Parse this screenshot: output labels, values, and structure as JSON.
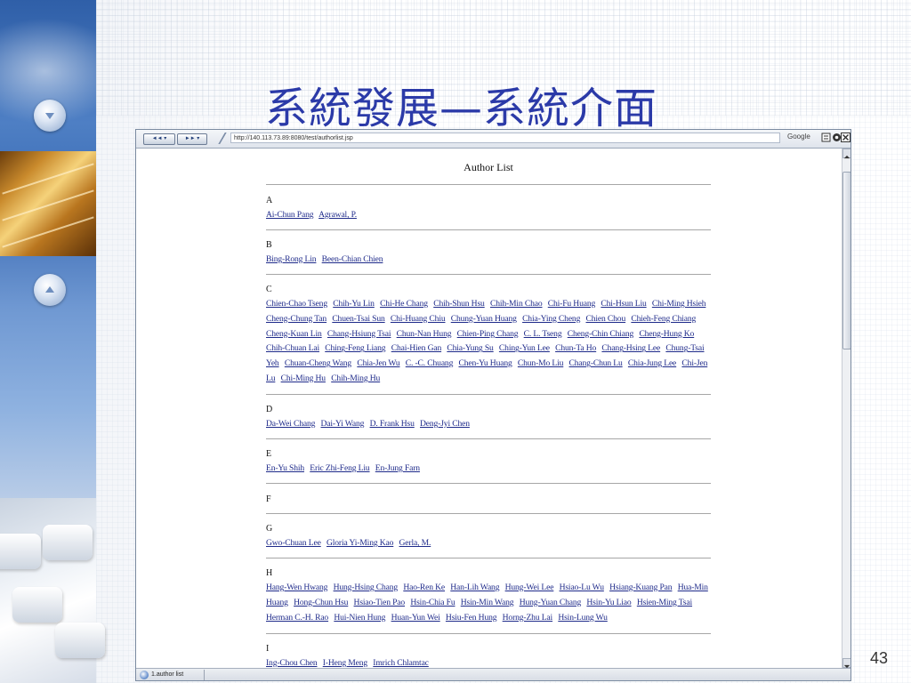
{
  "slide": {
    "title": "系統發展—系統介面",
    "page_number": "43"
  },
  "browser": {
    "back_label": "◄◄ ▾",
    "forward_label": "►► ▾",
    "address": "http://140.113.73.89:8080/test/authorlist.jsp",
    "search_engine": "Google",
    "status_text": "1.author list"
  },
  "author_list": {
    "title": "Author List",
    "sections": [
      {
        "letter": "A",
        "names": [
          "Ai-Chun Pang",
          "Agrawal, P."
        ]
      },
      {
        "letter": "B",
        "names": [
          "Bing-Rong Lin",
          "Been-Chian Chien"
        ]
      },
      {
        "letter": "C",
        "names": [
          "Chien-Chao Tseng",
          "Chih-Yu Lin",
          "Chi-He Chang",
          "Chih-Shun Hsu",
          "Chih-Min Chao",
          "Chi-Fu Huang",
          "Chi-Hsun Liu",
          "Chi-Ming Hsieh",
          "Cheng-Chung Tan",
          "Chuen-Tsai Sun",
          "Chi-Huang Chiu",
          "Chung-Yuan Huang",
          "Chia-Ying Cheng",
          "Chien Chou",
          "Chieh-Feng Chiang",
          "Cheng-Kuan Lin",
          "Chang-Hsiung Tsai",
          "Chun-Nan Hung",
          "Chien-Ping Chang",
          "C. L. Tseng",
          "Cheng-Chin Chiang",
          "Cheng-Hung Ko",
          "Chih-Chuan Lai",
          "Ching-Feng Liang",
          "Chai-Hien Gan",
          "Chia-Yung Su",
          "Ching-Yun Lee",
          "Chun-Ta Ho",
          "Chang-Hsing Lee",
          "Chung-Tsai Yeh",
          "Chuan-Cheng Wang",
          "Chia-Jen Wu",
          "C. -C. Chuang",
          "Chen-Yu Huang",
          "Chun-Mo Liu",
          "Chang-Chun Lu",
          "Chia-Jung Lee",
          "Chi-Jen Lu",
          "Chi-Ming Hu",
          "Chih-Ming Hu"
        ]
      },
      {
        "letter": "D",
        "names": [
          "Da-Wei Chang",
          "Dai-Yi Wang",
          "D. Frank Hsu",
          "Deng-Jyi Chen"
        ]
      },
      {
        "letter": "E",
        "names": [
          "En-Yu Shih",
          "Eric Zhi-Feng Liu",
          "En-Jung Farn"
        ]
      },
      {
        "letter": "F",
        "names": []
      },
      {
        "letter": "G",
        "names": [
          "Gwo-Chuan Lee",
          "Gloria Yi-Ming Kao",
          "Gerla, M."
        ]
      },
      {
        "letter": "H",
        "names": [
          "Hang-Wen Hwang",
          "Hung-Hsing Chang",
          "Hao-Ren Ke",
          "Han-Lih Wang",
          "Hung-Wei Lee",
          "Hsiao-Lu Wu",
          "Hsiang-Kuang Pan",
          "Hua-Min Huang",
          "Hong-Chun Hsu",
          "Hsiao-Tien Pao",
          "Hsin-Chia Fu",
          "Hsin-Min Wang",
          "Hung-Yuan Chang",
          "Hsin-Yu Liao",
          "Hsien-Ming Tsai",
          "Herman C.-H. Rao",
          "Hui-Nien Hung",
          "Huan-Yun Wei",
          "Hsiu-Fen Hung",
          "Horng-Zhu Lai",
          "Hsin-Lung Wu"
        ]
      },
      {
        "letter": "I",
        "names": [
          "Ing-Chou Chen",
          "I-Heng Meng",
          "Imrich Chlamtac"
        ]
      }
    ]
  },
  "colors": {
    "title": "#2b3aa8",
    "link": "#1e2a8a",
    "divider": "#a6a6a6"
  },
  "icons": {
    "nav_down": "chevron-down-circle-icon",
    "nav_up": "chevron-up-circle-icon",
    "status": "globe-icon"
  }
}
